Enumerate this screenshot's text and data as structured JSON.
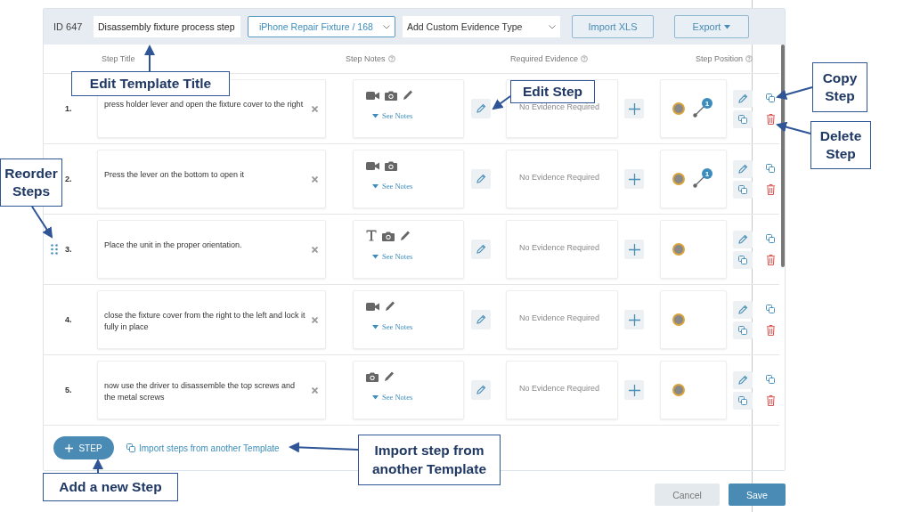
{
  "header": {
    "id_label": "ID 647",
    "title_field": "Disassembly fixture process step",
    "fixture_select": "iPhone Repair Fixture / 168",
    "evidence_select": "Add Custom Evidence Type",
    "import_button": "Import XLS",
    "export_button": "Export"
  },
  "columns": [
    "Step Title",
    "Step Notes",
    "Required Evidence",
    "Step Position"
  ],
  "rows": [
    {
      "number": "1.",
      "title": "press holder lever and open the fixture cover to the right",
      "note_types": [
        {
          "kind": "video"
        },
        {
          "kind": "camera"
        },
        {
          "kind": "pencil"
        }
      ],
      "see_notes": "See Notes",
      "evidence": "No Evidence Required",
      "branch_count": "1",
      "drag_handle": false
    },
    {
      "number": "2.",
      "title": "Press the lever on the bottom to open it",
      "note_types": [
        {
          "kind": "video"
        },
        {
          "kind": "camera"
        }
      ],
      "see_notes": "See Notes",
      "evidence": "No Evidence Required",
      "branch_count": "1",
      "drag_handle": false
    },
    {
      "number": "3.",
      "title": "Place the unit in the proper orientation.",
      "note_types": [
        {
          "kind": "text"
        },
        {
          "kind": "camera"
        },
        {
          "kind": "pencil"
        }
      ],
      "see_notes": "See Notes",
      "evidence": "No Evidence Required",
      "drag_handle": true
    },
    {
      "number": "4.",
      "title": "close the fixture cover from the right to the left and lock it fully in place",
      "note_types": [
        {
          "kind": "video"
        },
        {
          "kind": "pencil"
        }
      ],
      "see_notes": "See Notes",
      "evidence": "No Evidence Required",
      "drag_handle": false
    },
    {
      "number": "5.",
      "title": "now use the driver to disassemble the top screws and the metal screws",
      "note_types": [
        {
          "kind": "camera"
        },
        {
          "kind": "pencil"
        }
      ],
      "see_notes": "See Notes",
      "evidence": "No Evidence Required",
      "drag_handle": false
    }
  ],
  "add_step_button": "STEP",
  "import_link": "Import steps from another Template",
  "footer": {
    "cancel": "Cancel",
    "save": "Save"
  },
  "annotations": [
    {
      "text": "Edit Template Title"
    },
    {
      "text": "Reorder Steps"
    },
    {
      "text": "Edit Step"
    },
    {
      "text": "Copy Step"
    },
    {
      "text": "Delete Step"
    },
    {
      "text": "Add a new Step"
    },
    {
      "text": "Import step from another Template"
    }
  ]
}
